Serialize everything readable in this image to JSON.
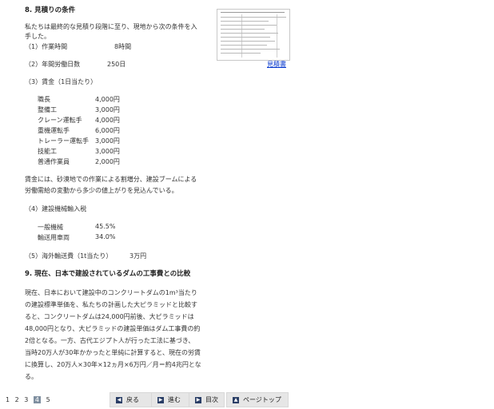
{
  "section8": {
    "heading": "8. 見積りの条件",
    "intro_line1": "私たちは最終的な見積り段階に至り、現地から次の条件を入",
    "intro_line2": "手した。",
    "work_hours": {
      "label": "（1）作業時間",
      "value": "8時間"
    },
    "working_days": {
      "label": "（2）年間労働日数",
      "value": "250日"
    },
    "wage": {
      "heading": "（3）賃金（1日当たり）",
      "rows": [
        {
          "job": "職長",
          "amount": "4,000円"
        },
        {
          "job": "整備工",
          "amount": "3,000円"
        },
        {
          "job": "クレーン運転手",
          "amount": "4,000円"
        },
        {
          "job": "重機運転手",
          "amount": "6,000円"
        },
        {
          "job": "トレーラー運転手",
          "amount": "3,000円"
        },
        {
          "job": "技能工",
          "amount": "3,000円"
        },
        {
          "job": "普通作業員",
          "amount": "2,000円"
        }
      ],
      "note_line1": "賃金には、砂漠地での作業による割増分、建設ブームによる",
      "note_line2": "労働需給の変動から多少の値上がりを見込んでいる。"
    },
    "tax": {
      "heading": "（4）建設機械輸入税",
      "rows": [
        {
          "item": "一般機械",
          "rate": "45.5%"
        },
        {
          "item": "輸送用車両",
          "rate": "34.0%"
        }
      ]
    },
    "shipping": {
      "label": "（5）海外輸送費（1t当たり）",
      "value": "3万円"
    },
    "estimate_link": "見積書"
  },
  "section9": {
    "heading": "9. 現在、日本で建設されているダムの工事費との比較",
    "lines": [
      "現在、日本において建設中のコンクリートダムの1m³当たり",
      "の建設標準単価を、私たちの計画した大ピラミッドと比較す",
      "ると、コンクリートダムは24,000円前後、大ピラミッドは",
      "48,000円となり、大ピラミッドの建設単価はダム工事費の約",
      "2倍となる。一方、古代エジプト人が行った工法に基づき、",
      "当時20万人が30年かかったと単純に計算すると、現在の労賃",
      "に換算し、20万人×30年×12ヵ月×6万円／月＝約4兆円とな",
      "る。"
    ]
  },
  "pagination": {
    "pages": [
      "1",
      "2",
      "3",
      "4",
      "5"
    ],
    "current": "4"
  },
  "nav": {
    "back": "戻る",
    "next": "進む",
    "toc": "目次",
    "top": "ページトップ"
  }
}
